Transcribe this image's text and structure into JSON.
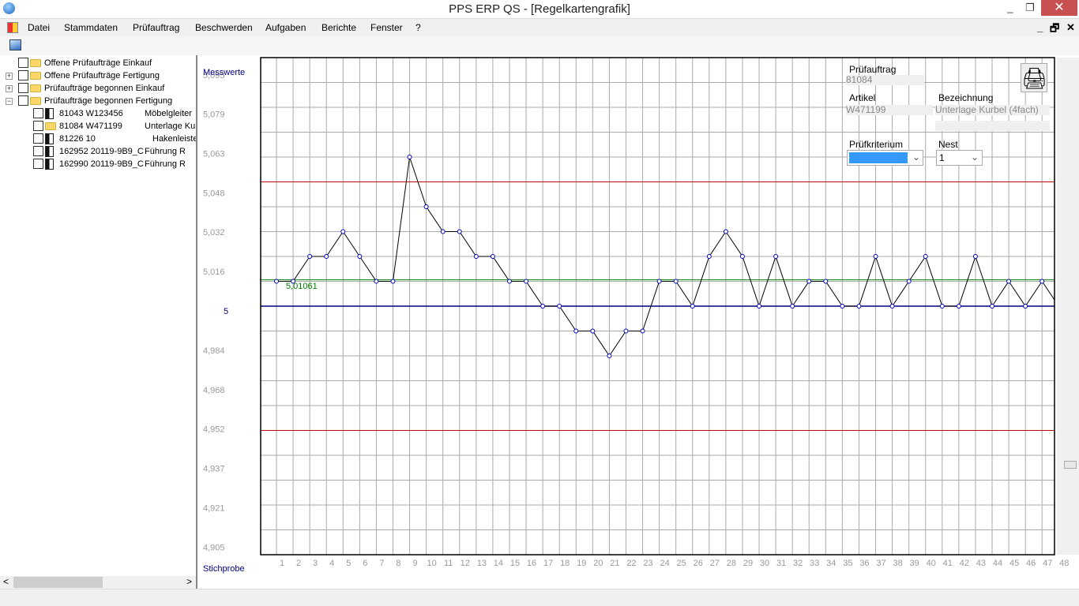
{
  "window": {
    "title": "PPS ERP QS - [Regelkartengrafik]",
    "minimize": "_",
    "restore": "❐",
    "close": "✕"
  },
  "menu": [
    "Datei",
    "Stammdaten",
    "Prüfauftrag",
    "Beschwerden",
    "Aufgaben",
    "Berichte",
    "Fenster",
    "?"
  ],
  "mdi": {
    "minimize": "_",
    "restore": "🗗",
    "close": "✕"
  },
  "tree": [
    {
      "label": "Offene Prüfaufträge Einkauf",
      "level": 0,
      "icon": "folder-icon",
      "expander": ""
    },
    {
      "label": "Offene Prüfaufträge Fertigung",
      "level": 0,
      "icon": "folder-icon",
      "expander": "+"
    },
    {
      "label": "Prüfaufträge begonnen Einkauf",
      "level": 0,
      "icon": "folder-open-icon",
      "expander": "+"
    },
    {
      "label": "Prüfaufträge begonnen Fertigung",
      "level": 0,
      "icon": "folder-open-icon",
      "expander": "−"
    },
    {
      "label": "81043 W123456",
      "desc": "Möbelgleiter",
      "level": 1,
      "icon": "document-icon"
    },
    {
      "label": "81084 W471199",
      "desc": "Unterlage Kurbel",
      "level": 1,
      "icon": "folder-icon"
    },
    {
      "label": "81226 10",
      "desc": "Hakenleiste",
      "level": 1,
      "icon": "document-icon"
    },
    {
      "label": "162952 20119-9B9_C",
      "desc": "Führung R",
      "level": 1,
      "icon": "document-icon"
    },
    {
      "label": "162990 20119-9B9_C",
      "desc": "Führung R",
      "level": 1,
      "icon": "document-icon"
    }
  ],
  "scroll": {
    "left": "<",
    "right": ">"
  },
  "panel": {
    "pruefauftrag_label": "Prüfauftrag",
    "pruefauftrag": "81084",
    "artikel_label": "Artikel",
    "artikel": "W471199",
    "bezeichnung_label": "Bezeichnung",
    "bezeichnung": "Unterlage Kurbel (4fach)",
    "pruefkriterium_label": "Prüfkriterium",
    "nest_label": "Nest",
    "nest": "1",
    "chev": "⌄"
  },
  "chart_data": {
    "type": "line",
    "ylabel": "Messwerte",
    "xlabel": "Stichprobe",
    "ylim": [
      4.9,
      5.1
    ],
    "yticks": [
      "5,095",
      "5,079",
      "5,063",
      "5,048",
      "5,032",
      "5,016",
      "5",
      "4,984",
      "4,968",
      "4,952",
      "4,937",
      "4,921",
      "4,905"
    ],
    "ytick_values": [
      5.095,
      5.0792,
      5.0633,
      5.0475,
      5.0317,
      5.0158,
      5.0,
      4.9842,
      4.9683,
      4.9525,
      4.9367,
      4.9208,
      4.905
    ],
    "x": [
      1,
      2,
      3,
      4,
      5,
      6,
      7,
      8,
      9,
      10,
      11,
      12,
      13,
      14,
      15,
      16,
      17,
      18,
      19,
      20,
      21,
      22,
      23,
      24,
      25,
      26,
      27,
      28,
      29,
      30,
      31,
      32,
      33,
      34,
      35,
      36,
      37,
      38,
      39,
      40,
      41,
      42,
      43,
      44,
      45,
      46,
      47,
      48
    ],
    "values": [
      5.01,
      5.01,
      5.02,
      5.02,
      5.03,
      5.02,
      5.01,
      5.01,
      5.06,
      5.04,
      5.03,
      5.03,
      5.02,
      5.02,
      5.01,
      5.01,
      5.0,
      5.0,
      4.99,
      4.99,
      4.98,
      4.99,
      4.99,
      5.01,
      5.01,
      5.0,
      5.02,
      5.03,
      5.02,
      5.0,
      5.02,
      5.0,
      5.01,
      5.01,
      5.0,
      5.0,
      5.02,
      5.0,
      5.01,
      5.02,
      5.0,
      5.0,
      5.02,
      5.0,
      5.01,
      5.0,
      5.01,
      5.0
    ],
    "ucl": 5.05,
    "lcl": 4.95,
    "target": 5.0,
    "mean": 5.01061,
    "mean_label": "5,01061",
    "colors": {
      "limits": "#c00000",
      "mean": "#008000",
      "target": "#000080",
      "line": "#000000",
      "points": "#0000c0"
    }
  }
}
